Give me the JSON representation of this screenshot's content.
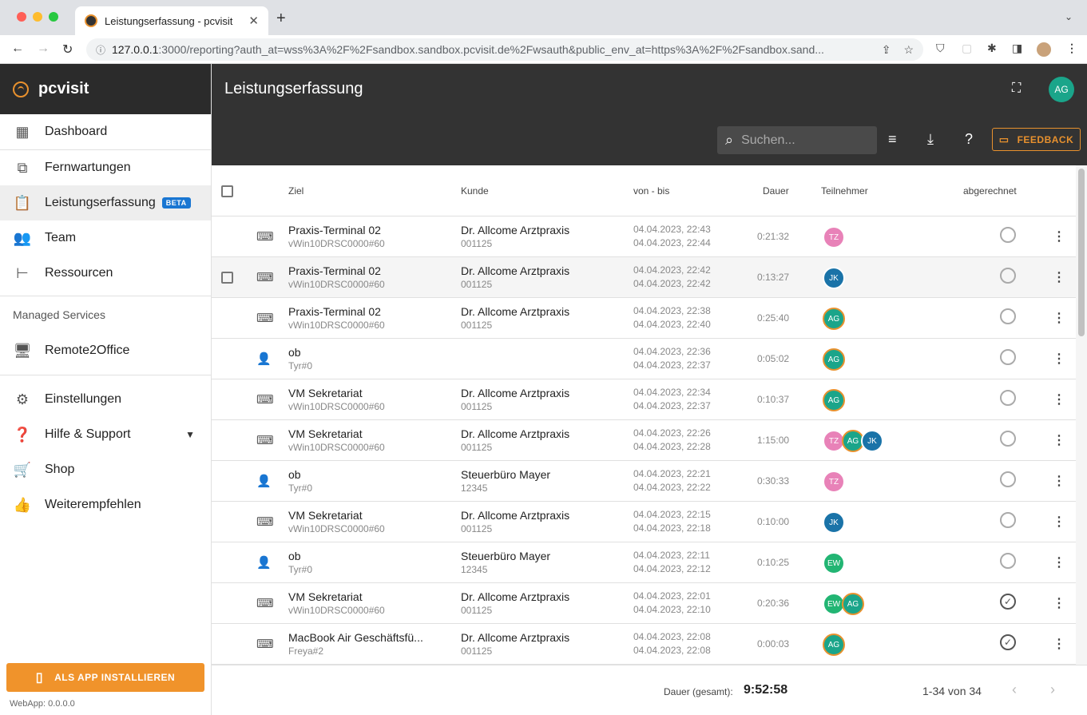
{
  "browser": {
    "tab_title": "Leistungserfassung - pcvisit",
    "url_host": "127.0.0.1",
    "url_rest": ":3000/reporting?auth_at=wss%3A%2F%2Fsandbox.sandbox.pcvisit.de%2Fwsauth&public_env_at=https%3A%2F%2Fsandbox.sand..."
  },
  "sidebar": {
    "brand": "pcvisit",
    "items": [
      {
        "label": "Dashboard",
        "icon": "dashboard-icon"
      },
      {
        "label": "Fernwartungen",
        "icon": "remote-icon"
      },
      {
        "label": "Leistungserfassung",
        "icon": "clipboard-clock-icon",
        "badge": "BETA"
      },
      {
        "label": "Team",
        "icon": "people-icon"
      },
      {
        "label": "Ressourcen",
        "icon": "tree-icon"
      }
    ],
    "section_label": "Managed Services",
    "managed": [
      {
        "label": "Remote2Office",
        "icon": "monitor-icon"
      }
    ],
    "bottom": [
      {
        "label": "Einstellungen",
        "icon": "gear-icon"
      },
      {
        "label": "Hilfe & Support",
        "icon": "help-icon"
      },
      {
        "label": "Shop",
        "icon": "cart-icon"
      },
      {
        "label": "Weiterempfehlen",
        "icon": "thumb-up-icon"
      }
    ],
    "install_label": "ALS APP INSTALLIEREN",
    "version": "WebApp: 0.0.0.0"
  },
  "header": {
    "title": "Leistungserfassung",
    "avatar": "AG",
    "search_placeholder": "Suchen...",
    "feedback_label": "FEEDBACK"
  },
  "table": {
    "columns": {
      "ziel": "Ziel",
      "kunde": "Kunde",
      "zeit": "von - bis",
      "dauer": "Dauer",
      "teilnehmer": "Teilnehmer",
      "abgerechnet": "abgerechnet"
    },
    "rows": [
      {
        "type": "device",
        "ziel": "Praxis-Terminal 02",
        "ziel_sub": "vWin10DRSC0000#60",
        "kunde": "Dr. Allcome Arztpraxis",
        "kunde_sub": "001125",
        "von": "04.04.2023, 22:43",
        "bis": "04.04.2023, 22:44",
        "dauer": "0:21:32",
        "parts": [
          "TZ"
        ],
        "billed": false
      },
      {
        "type": "device",
        "ziel": "Praxis-Terminal 02",
        "ziel_sub": "vWin10DRSC0000#60",
        "kunde": "Dr. Allcome Arztpraxis",
        "kunde_sub": "001125",
        "von": "04.04.2023, 22:42",
        "bis": "04.04.2023, 22:42",
        "dauer": "0:13:27",
        "parts": [
          "JK"
        ],
        "billed": false
      },
      {
        "type": "device",
        "ziel": "Praxis-Terminal 02",
        "ziel_sub": "vWin10DRSC0000#60",
        "kunde": "Dr. Allcome Arztpraxis",
        "kunde_sub": "001125",
        "von": "04.04.2023, 22:38",
        "bis": "04.04.2023, 22:40",
        "dauer": "0:25:40",
        "parts": [
          "AG"
        ],
        "billed": false
      },
      {
        "type": "person",
        "ziel": "ob",
        "ziel_sub": "Tyr#0",
        "kunde": "",
        "kunde_sub": "",
        "von": "04.04.2023, 22:36",
        "bis": "04.04.2023, 22:37",
        "dauer": "0:05:02",
        "parts": [
          "AG"
        ],
        "billed": false
      },
      {
        "type": "device",
        "ziel": "VM Sekretariat",
        "ziel_sub": "vWin10DRSC0000#60",
        "kunde": "Dr. Allcome Arztpraxis",
        "kunde_sub": "001125",
        "von": "04.04.2023, 22:34",
        "bis": "04.04.2023, 22:37",
        "dauer": "0:10:37",
        "parts": [
          "AG"
        ],
        "billed": false
      },
      {
        "type": "device",
        "ziel": "VM Sekretariat",
        "ziel_sub": "vWin10DRSC0000#60",
        "kunde": "Dr. Allcome Arztpraxis",
        "kunde_sub": "001125",
        "von": "04.04.2023, 22:26",
        "bis": "04.04.2023, 22:28",
        "dauer": "1:15:00",
        "parts": [
          "TZ",
          "AG",
          "JK"
        ],
        "billed": false
      },
      {
        "type": "person",
        "ziel": "ob",
        "ziel_sub": "Tyr#0",
        "kunde": "Steuerbüro Mayer",
        "kunde_sub": "12345",
        "von": "04.04.2023, 22:21",
        "bis": "04.04.2023, 22:22",
        "dauer": "0:30:33",
        "parts": [
          "TZ"
        ],
        "billed": false
      },
      {
        "type": "device",
        "ziel": "VM Sekretariat",
        "ziel_sub": "vWin10DRSC0000#60",
        "kunde": "Dr. Allcome Arztpraxis",
        "kunde_sub": "001125",
        "von": "04.04.2023, 22:15",
        "bis": "04.04.2023, 22:18",
        "dauer": "0:10:00",
        "parts": [
          "JK"
        ],
        "billed": false
      },
      {
        "type": "person",
        "ziel": "ob",
        "ziel_sub": "Tyr#0",
        "kunde": "Steuerbüro Mayer",
        "kunde_sub": "12345",
        "von": "04.04.2023, 22:11",
        "bis": "04.04.2023, 22:12",
        "dauer": "0:10:25",
        "parts": [
          "EW"
        ],
        "billed": false
      },
      {
        "type": "device",
        "ziel": "VM Sekretariat",
        "ziel_sub": "vWin10DRSC0000#60",
        "kunde": "Dr. Allcome Arztpraxis",
        "kunde_sub": "001125",
        "von": "04.04.2023, 22:01",
        "bis": "04.04.2023, 22:10",
        "dauer": "0:20:36",
        "parts": [
          "EW",
          "AG"
        ],
        "billed": true
      },
      {
        "type": "device",
        "ziel": "MacBook Air Geschäftsfü...",
        "ziel_sub": "Freya#2",
        "kunde": "Dr. Allcome Arztpraxis",
        "kunde_sub": "001125",
        "von": "04.04.2023, 22:08",
        "bis": "04.04.2023, 22:08",
        "dauer": "0:00:03",
        "parts": [
          "AG"
        ],
        "billed": true
      }
    ]
  },
  "footer": {
    "total_label": "Dauer (gesamt):",
    "total_value": "9:52:58",
    "pagination": "1-34 von 34"
  },
  "colors": {
    "TZ": "#e882b8",
    "JK": "#1a73a8",
    "AG": "#1aa58a",
    "EW": "#22b573",
    "accent": "#e8912e"
  }
}
